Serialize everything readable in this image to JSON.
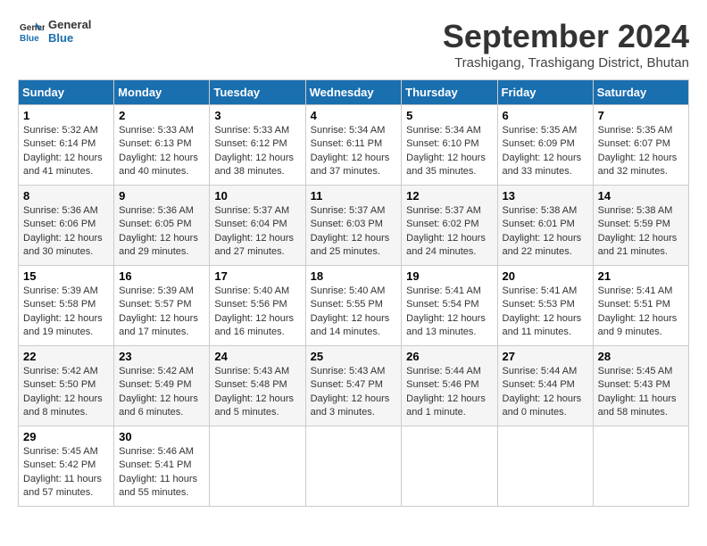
{
  "header": {
    "logo_general": "General",
    "logo_blue": "Blue",
    "month_title": "September 2024",
    "location": "Trashigang, Trashigang District, Bhutan"
  },
  "weekdays": [
    "Sunday",
    "Monday",
    "Tuesday",
    "Wednesday",
    "Thursday",
    "Friday",
    "Saturday"
  ],
  "weeks": [
    [
      {
        "day": "1",
        "sunrise": "5:32 AM",
        "sunset": "6:14 PM",
        "daylight": "12 hours and 41 minutes."
      },
      {
        "day": "2",
        "sunrise": "5:33 AM",
        "sunset": "6:13 PM",
        "daylight": "12 hours and 40 minutes."
      },
      {
        "day": "3",
        "sunrise": "5:33 AM",
        "sunset": "6:12 PM",
        "daylight": "12 hours and 38 minutes."
      },
      {
        "day": "4",
        "sunrise": "5:34 AM",
        "sunset": "6:11 PM",
        "daylight": "12 hours and 37 minutes."
      },
      {
        "day": "5",
        "sunrise": "5:34 AM",
        "sunset": "6:10 PM",
        "daylight": "12 hours and 35 minutes."
      },
      {
        "day": "6",
        "sunrise": "5:35 AM",
        "sunset": "6:09 PM",
        "daylight": "12 hours and 33 minutes."
      },
      {
        "day": "7",
        "sunrise": "5:35 AM",
        "sunset": "6:07 PM",
        "daylight": "12 hours and 32 minutes."
      }
    ],
    [
      {
        "day": "8",
        "sunrise": "5:36 AM",
        "sunset": "6:06 PM",
        "daylight": "12 hours and 30 minutes."
      },
      {
        "day": "9",
        "sunrise": "5:36 AM",
        "sunset": "6:05 PM",
        "daylight": "12 hours and 29 minutes."
      },
      {
        "day": "10",
        "sunrise": "5:37 AM",
        "sunset": "6:04 PM",
        "daylight": "12 hours and 27 minutes."
      },
      {
        "day": "11",
        "sunrise": "5:37 AM",
        "sunset": "6:03 PM",
        "daylight": "12 hours and 25 minutes."
      },
      {
        "day": "12",
        "sunrise": "5:37 AM",
        "sunset": "6:02 PM",
        "daylight": "12 hours and 24 minutes."
      },
      {
        "day": "13",
        "sunrise": "5:38 AM",
        "sunset": "6:01 PM",
        "daylight": "12 hours and 22 minutes."
      },
      {
        "day": "14",
        "sunrise": "5:38 AM",
        "sunset": "5:59 PM",
        "daylight": "12 hours and 21 minutes."
      }
    ],
    [
      {
        "day": "15",
        "sunrise": "5:39 AM",
        "sunset": "5:58 PM",
        "daylight": "12 hours and 19 minutes."
      },
      {
        "day": "16",
        "sunrise": "5:39 AM",
        "sunset": "5:57 PM",
        "daylight": "12 hours and 17 minutes."
      },
      {
        "day": "17",
        "sunrise": "5:40 AM",
        "sunset": "5:56 PM",
        "daylight": "12 hours and 16 minutes."
      },
      {
        "day": "18",
        "sunrise": "5:40 AM",
        "sunset": "5:55 PM",
        "daylight": "12 hours and 14 minutes."
      },
      {
        "day": "19",
        "sunrise": "5:41 AM",
        "sunset": "5:54 PM",
        "daylight": "12 hours and 13 minutes."
      },
      {
        "day": "20",
        "sunrise": "5:41 AM",
        "sunset": "5:53 PM",
        "daylight": "12 hours and 11 minutes."
      },
      {
        "day": "21",
        "sunrise": "5:41 AM",
        "sunset": "5:51 PM",
        "daylight": "12 hours and 9 minutes."
      }
    ],
    [
      {
        "day": "22",
        "sunrise": "5:42 AM",
        "sunset": "5:50 PM",
        "daylight": "12 hours and 8 minutes."
      },
      {
        "day": "23",
        "sunrise": "5:42 AM",
        "sunset": "5:49 PM",
        "daylight": "12 hours and 6 minutes."
      },
      {
        "day": "24",
        "sunrise": "5:43 AM",
        "sunset": "5:48 PM",
        "daylight": "12 hours and 5 minutes."
      },
      {
        "day": "25",
        "sunrise": "5:43 AM",
        "sunset": "5:47 PM",
        "daylight": "12 hours and 3 minutes."
      },
      {
        "day": "26",
        "sunrise": "5:44 AM",
        "sunset": "5:46 PM",
        "daylight": "12 hours and 1 minute."
      },
      {
        "day": "27",
        "sunrise": "5:44 AM",
        "sunset": "5:44 PM",
        "daylight": "12 hours and 0 minutes."
      },
      {
        "day": "28",
        "sunrise": "5:45 AM",
        "sunset": "5:43 PM",
        "daylight": "11 hours and 58 minutes."
      }
    ],
    [
      {
        "day": "29",
        "sunrise": "5:45 AM",
        "sunset": "5:42 PM",
        "daylight": "11 hours and 57 minutes."
      },
      {
        "day": "30",
        "sunrise": "5:46 AM",
        "sunset": "5:41 PM",
        "daylight": "11 hours and 55 minutes."
      },
      null,
      null,
      null,
      null,
      null
    ]
  ]
}
